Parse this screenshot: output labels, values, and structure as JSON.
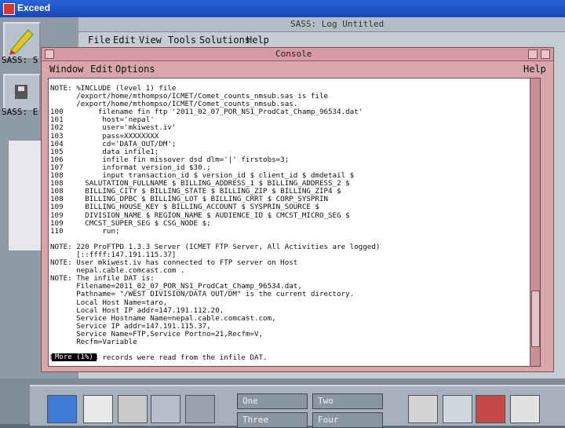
{
  "window": {
    "title": "Exceed"
  },
  "launcher": {
    "label_1": "SASS: S",
    "label_2": "SASS: E"
  },
  "bg_window": {
    "title": "SASS: Log Untitled",
    "menu": [
      "File",
      "Edit",
      "View",
      "Tools",
      "Solutions",
      "Help"
    ]
  },
  "console": {
    "title": "Console",
    "menu": {
      "window": "Window",
      "edit": "Edit",
      "options": "Options",
      "help": "Help"
    },
    "lines": [
      "NOTE: %INCLUDE (level 1) file",
      "      /export/home/mthompso/ICMET/Comet_counts_nmsub.sas is file",
      "      /export/home/mthompso/ICMET/Comet_counts_nmsub.sas.",
      "100        filename fin ftp '2011_02_07_POR_NS1_ProdCat_Champ_96534.dat'",
      "101         host='nepal'",
      "102         user='mkiwest.iv'",
      "103         pass=XXXXXXXX",
      "104         cd='DATA_OUT/DM';",
      "105         data infile1;",
      "106         infile fin missover dsd dlm='|' firstobs=3;",
      "107         informat version_id $30.;",
      "108         input transaction_id $ version_id $ client_id $ dmdetail $",
      "108     SALUTATION_FULLNAME $ BILLING_ADDRESS_1 $ BILLING_ADDRESS_2 $",
      "108     BILLING_CITY $ BILLING_STATE $ BILLING_ZIP $ BILLING_ZIP4 $",
      "108     BILLING_DPBC $ BILLING_LOT $ BILLING_CRRT $ CORP_SYSPRIN",
      "109     BILLING_HOUSE_KEY $ BILLING_ACCOUNT $ SYSPRIN_SOURCE $",
      "109     DIVISION_NAME $ REGION_NAME $ AUDIENCE_ID $ CMCST_MICRO_SEG $",
      "109     CMCST_SUPER_SEG $ CSG_NODE $;",
      "110         run;",
      "",
      "NOTE: 220 ProFTPD 1.3.3 Server (ICMET FTP Server, All Activities are logged)",
      "      [::ffff:147.191.115.37]",
      "NOTE: User mkiwest.iv has connected to FTP server on Host",
      "      nepal.cable.comcast.com .",
      "NOTE: The infile DAT is:",
      "      Filename=2011_02_07_POR_NS1_ProdCat_Champ_96534.dat,",
      "      Pathname= \"/WEST DIVISION/DATA OUT/DM\" is the current directory.",
      "      Local Host Name=taro,",
      "      Local Host IP addr=147.191.112.20,",
      "      Service Hostname Name=nepal.cable.comcast.com,",
      "      Service IP addr=147.191.115.37,",
      "      Service Name=FTP,Service Portno=21,Recfm=V,",
      "      Recfm=Variable",
      "",
      "NOTE: 96534 records were read from the infile DAT."
    ],
    "status": "More (1%)"
  },
  "taskbar": {
    "workspaces": [
      "One",
      "Two",
      "Three",
      "Four"
    ]
  }
}
